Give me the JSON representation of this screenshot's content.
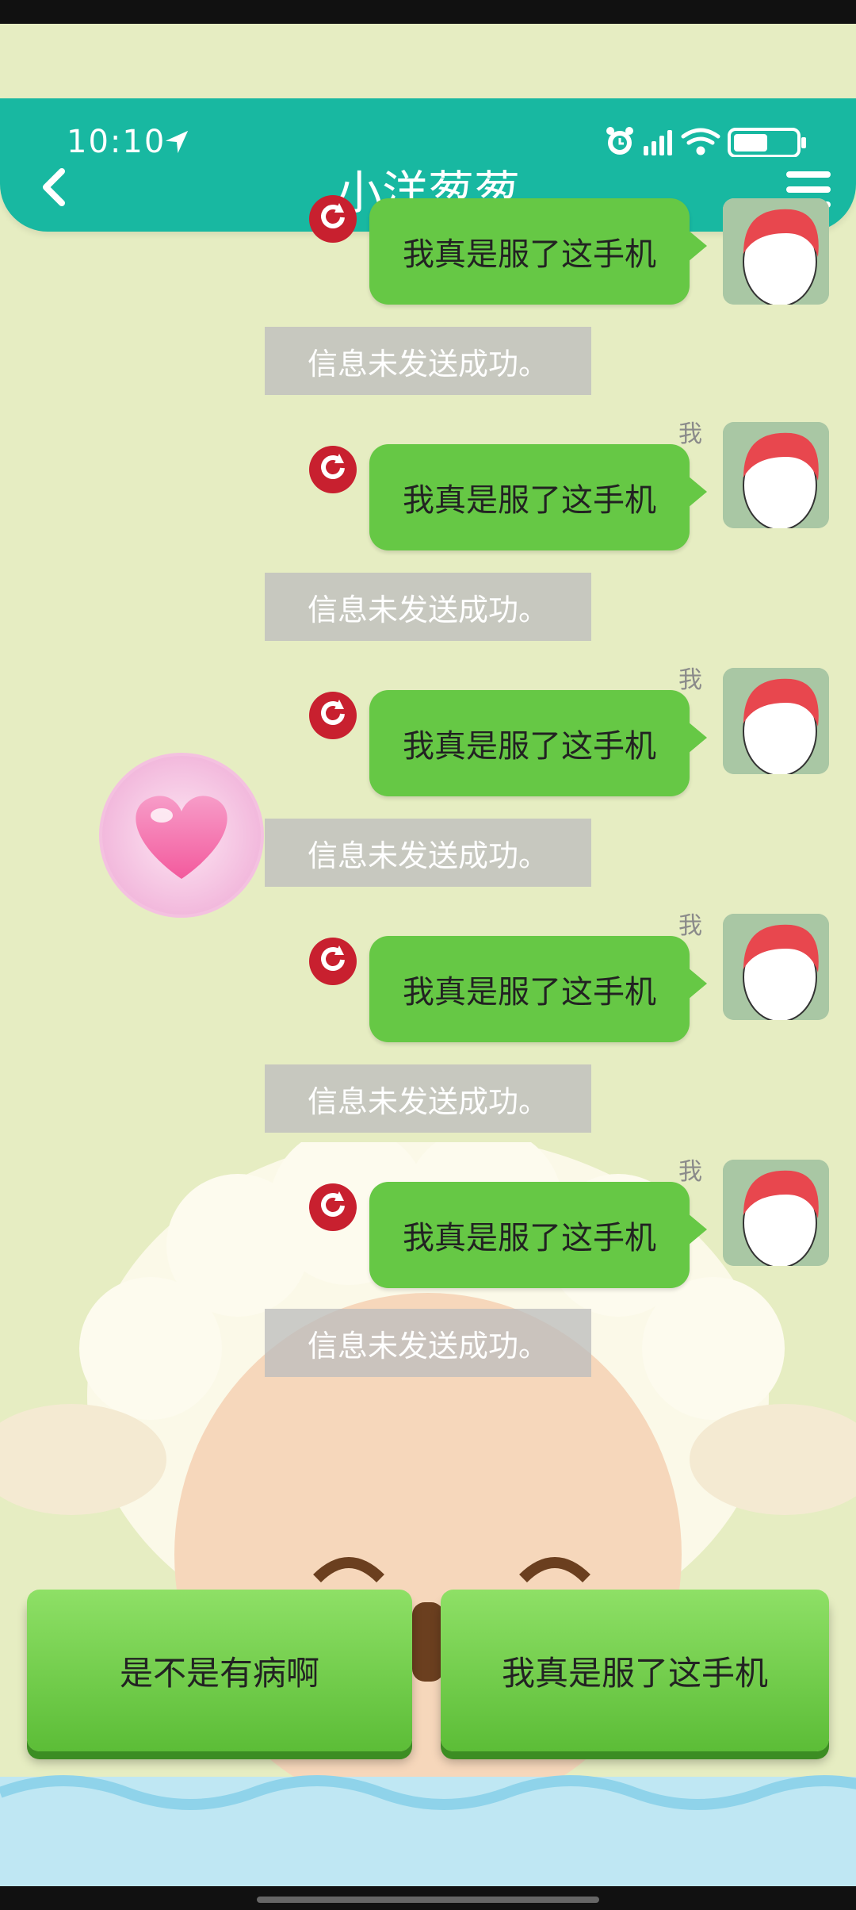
{
  "status_bar": {
    "time": "10:10"
  },
  "header": {
    "title": "小洋葱葱"
  },
  "chat": {
    "me_label": "我",
    "messages": [
      {
        "text": "我真是服了这手机",
        "notice": "信息未发送成功。"
      },
      {
        "text": "我真是服了这手机",
        "notice": "信息未发送成功。"
      },
      {
        "text": "我真是服了这手机",
        "notice": "信息未发送成功。"
      },
      {
        "text": "我真是服了这手机",
        "notice": "信息未发送成功。"
      },
      {
        "text": "我真是服了这手机",
        "notice": "信息未发送成功。"
      }
    ]
  },
  "replies": [
    {
      "label": "是不是有病啊"
    },
    {
      "label": "我真是服了这手机"
    }
  ],
  "colors": {
    "header": "#18b8a1",
    "bubble": "#66c845",
    "background": "#e6edc2",
    "resend": "#c8202f"
  },
  "icons": [
    "back-icon",
    "menu-icon",
    "location-arrow-icon",
    "alarm-icon",
    "signal-icon",
    "wifi-icon",
    "battery-icon",
    "resend-icon",
    "heart-icon"
  ]
}
